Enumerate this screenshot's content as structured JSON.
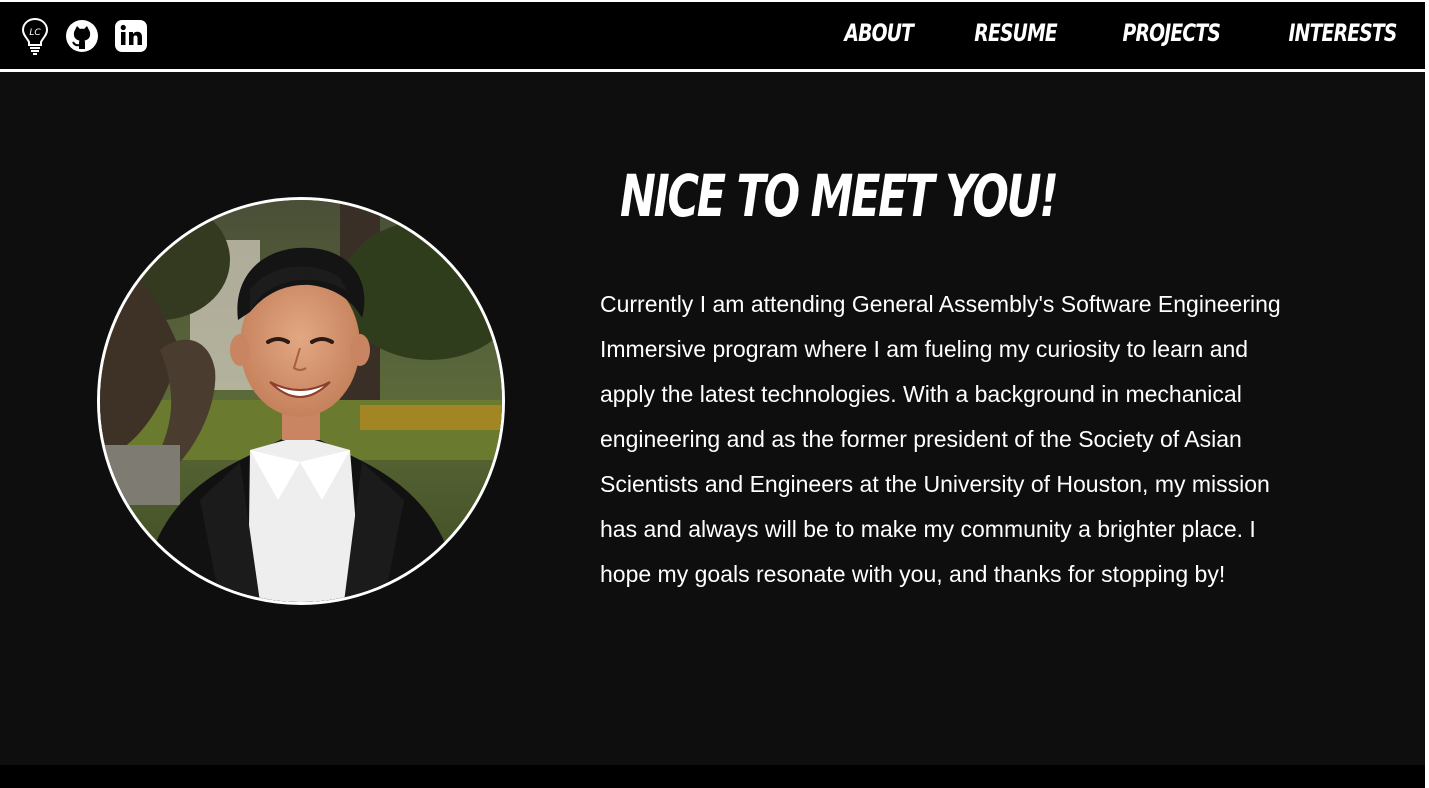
{
  "nav": {
    "icons": [
      "lightbulb-logo-icon",
      "github-icon",
      "linkedin-icon"
    ],
    "logo_initials": "LC",
    "links": [
      "ABOUT",
      "RESUME",
      "PROJECTS",
      "INTERESTS"
    ]
  },
  "hero": {
    "title": "NICE TO MEET YOU!",
    "bio": "Currently I am attending General Assembly's Software Engineering Immersive program where I am fueling my curiosity to learn and apply the latest technologies. With a background in mechanical engineering and as the former president of the Society of Asian Scientists and Engineers at the University of Houston, my mission has and always will be to make my community a brighter place. I hope my goals resonate with you, and thanks for stopping by!"
  },
  "colors": {
    "background": "#0e0e0e",
    "navbar": "#000000",
    "text": "#ffffff"
  }
}
